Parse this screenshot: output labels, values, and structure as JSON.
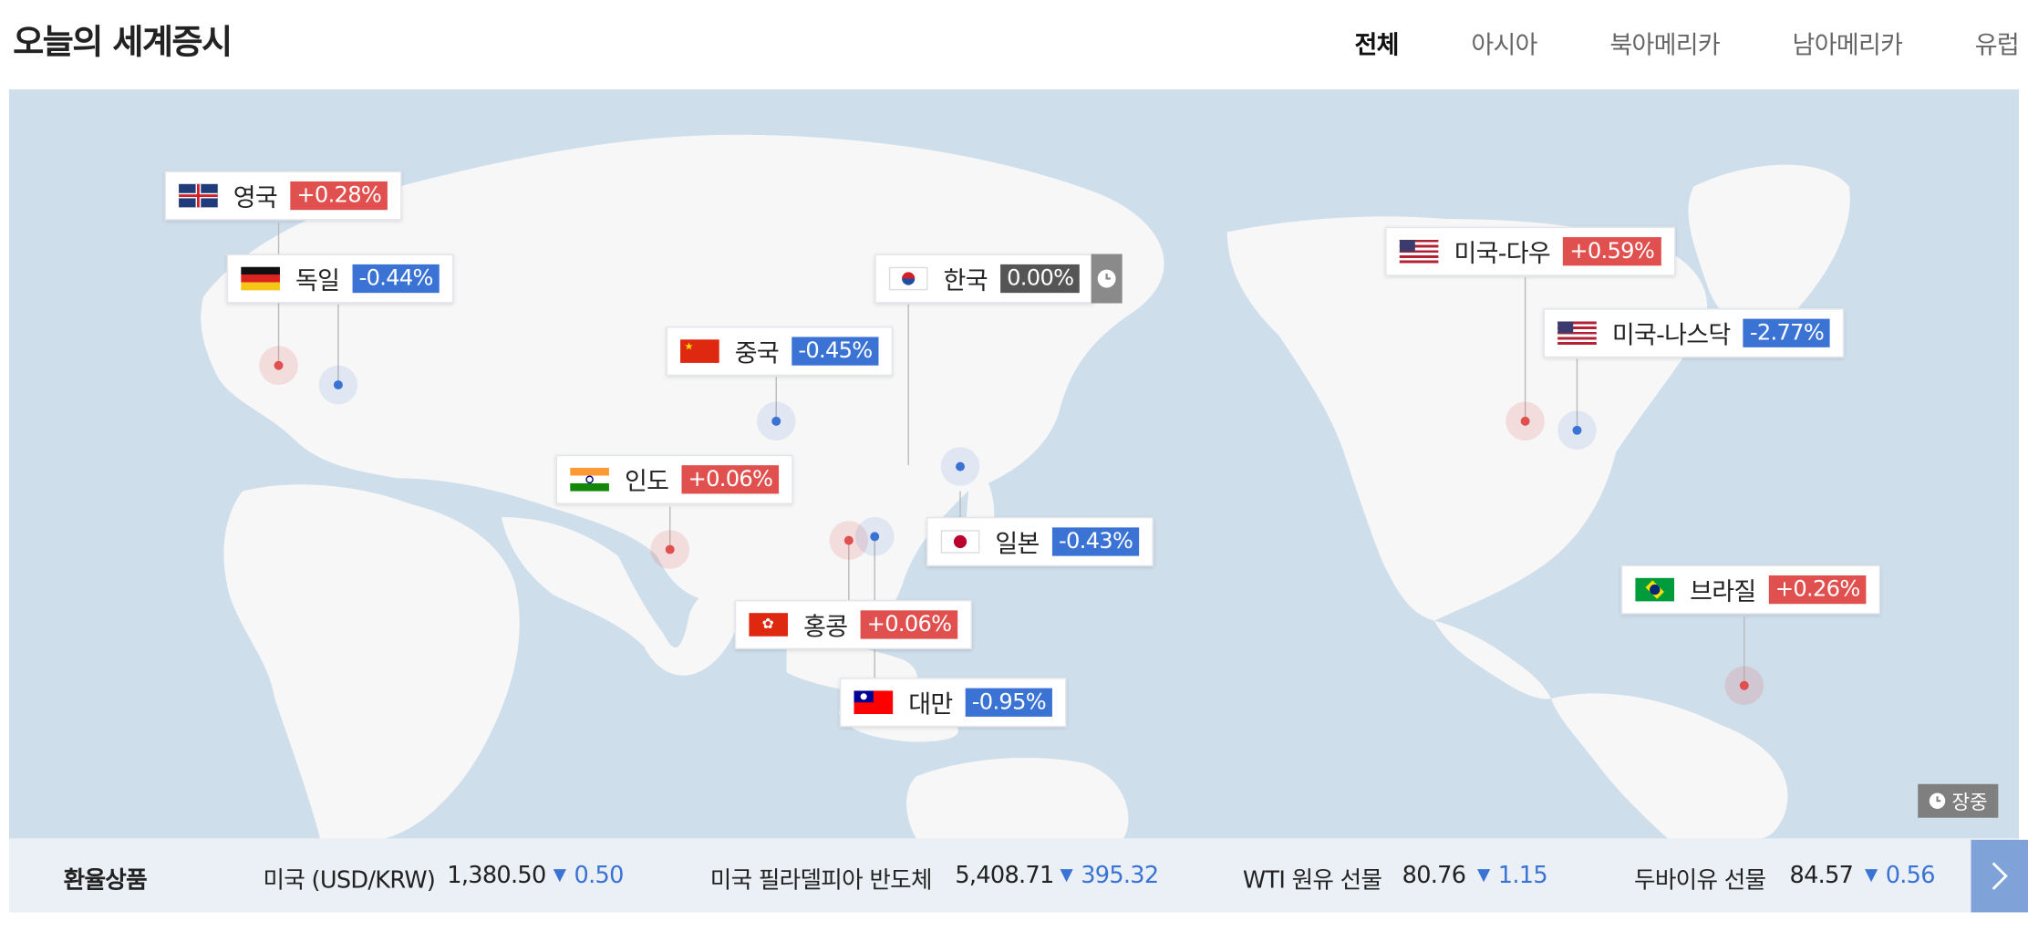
{
  "page_title": "오늘의 세계증시",
  "tabs": [
    "전체",
    "아시아",
    "북아메리카",
    "남아메리카",
    "유럽"
  ],
  "markets": [
    {
      "name": "영국",
      "change": "+0.28%",
      "dir": "up",
      "flag": "uk-flag-icon"
    },
    {
      "name": "독일",
      "change": "-0.44%",
      "dir": "down",
      "flag": "germany-flag-icon"
    },
    {
      "name": "한국",
      "change": "0.00%",
      "dir": "flat",
      "flag": "korea-flag-icon"
    },
    {
      "name": "중국",
      "change": "-0.45%",
      "dir": "down",
      "flag": "china-flag-icon"
    },
    {
      "name": "인도",
      "change": "+0.06%",
      "dir": "up",
      "flag": "india-flag-icon"
    },
    {
      "name": "일본",
      "change": "-0.43%",
      "dir": "down",
      "flag": "japan-flag-icon"
    },
    {
      "name": "홍콩",
      "change": "+0.06%",
      "dir": "up",
      "flag": "hongkong-flag-icon"
    },
    {
      "name": "대만",
      "change": "-0.95%",
      "dir": "down",
      "flag": "taiwan-flag-icon"
    },
    {
      "name": "미국-다우",
      "change": "+0.59%",
      "dir": "up",
      "flag": "usa-flag-icon"
    },
    {
      "name": "미국-나스닥",
      "change": "-2.77%",
      "dir": "down",
      "flag": "usa-flag-icon"
    },
    {
      "name": "브라질",
      "change": "+0.26%",
      "dir": "up",
      "flag": "brazil-flag-icon"
    }
  ],
  "status_badge": "장중",
  "colors": {
    "up": "#e0504e",
    "down": "#3b73d5",
    "flat": "#555555",
    "map_sea": "#cfdeeb",
    "land": "#f7f7f7"
  },
  "ticker": {
    "heading": "환율상품",
    "items": [
      {
        "label": "미국 (USD/KRW)",
        "value": "1,380.50",
        "delta": "0.50"
      },
      {
        "label": "미국 필라델피아 반도체",
        "value": "5,408.71",
        "delta": "395.32"
      },
      {
        "label": "WTI 원유 선물",
        "value": "80.76",
        "delta": "1.15"
      },
      {
        "label": "두바이유 선물",
        "value": "84.57",
        "delta": "0.56"
      }
    ]
  }
}
